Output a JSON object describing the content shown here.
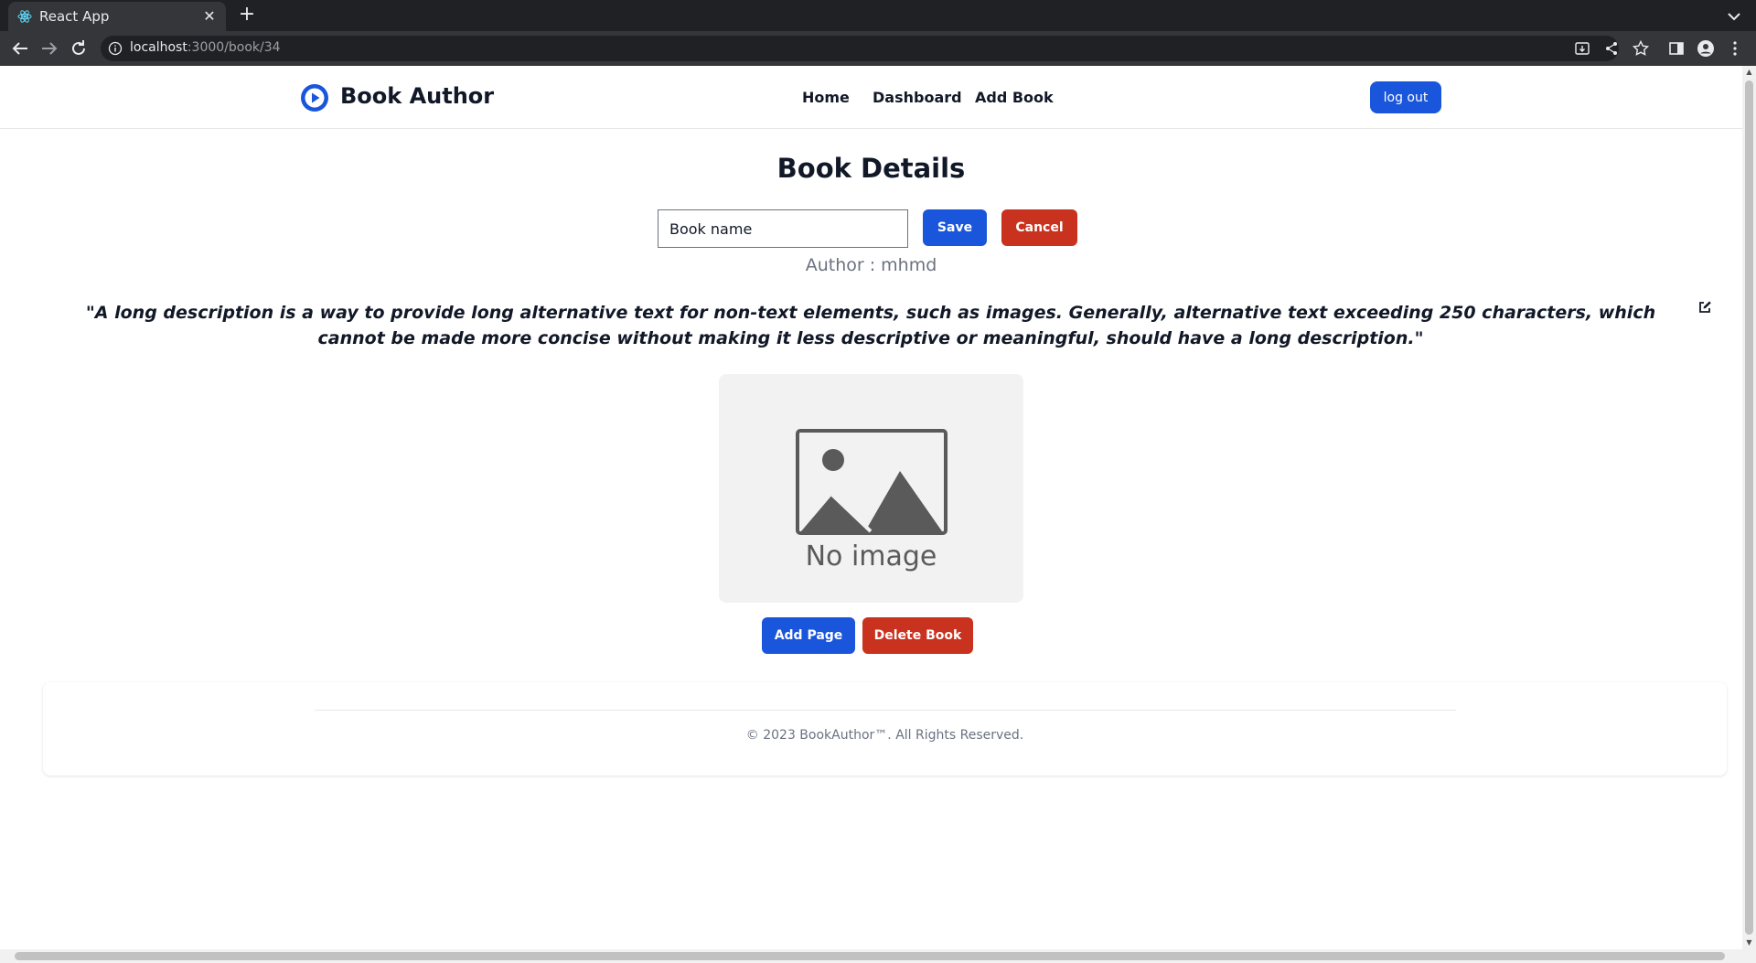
{
  "browser": {
    "tab_title": "React App",
    "url_host": "localhost",
    "url_path": ":3000/book/34",
    "close_glyph": "✕",
    "new_tab_glyph": "+"
  },
  "navbar": {
    "brand": "Book Author",
    "links": [
      "Home",
      "Dashboard",
      "Add Book"
    ],
    "logout_label": "log out"
  },
  "main": {
    "title": "Book Details",
    "name_input": {
      "value": "Book name",
      "placeholder": ""
    },
    "save_label": "Save",
    "cancel_label": "Cancel",
    "author_label": "Author : ",
    "author_name": "mhmd",
    "description": "\"A long description is a way to provide long alternative text for non-text elements, such as images. Generally, alternative text exceeding 250 characters, which cannot be made more concise without making it less descriptive or meaningful, should have a long description.\"",
    "no_image_label": "No image",
    "add_page_label": "Add Page",
    "delete_book_label": "Delete Book"
  },
  "footer": {
    "text": "© 2023 BookAuthor™. All Rights Reserved."
  },
  "colors": {
    "primary": "#1a56db",
    "danger": "#c8321f",
    "text": "#111827",
    "muted": "#6b7280"
  },
  "icons": {
    "favicon": "react-icon",
    "brand": "play-circle-icon",
    "edit": "edit-icon",
    "placeholder": "image-icon"
  }
}
